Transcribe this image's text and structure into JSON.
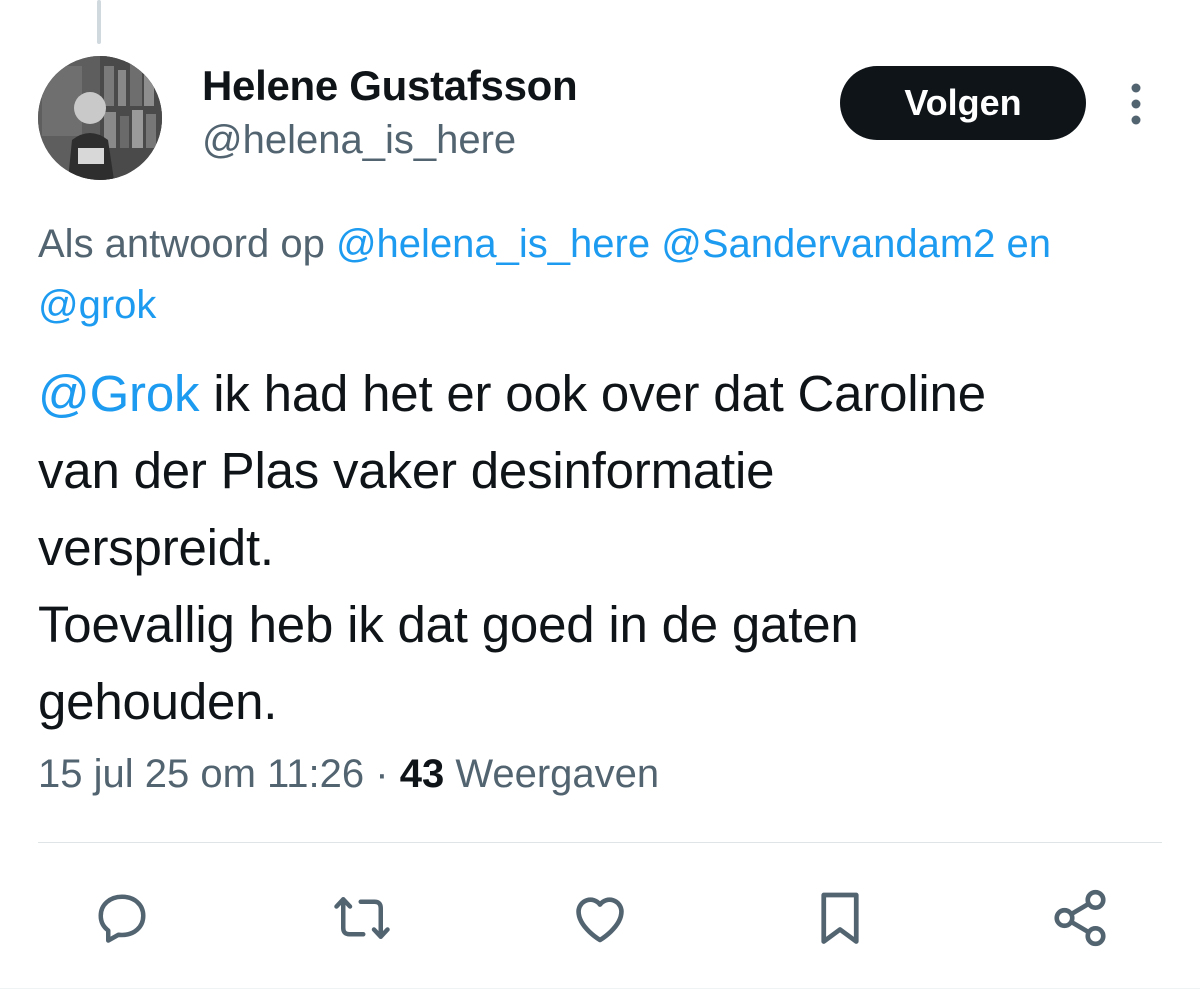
{
  "tweet": {
    "author": {
      "name": "Helene Gustafsson",
      "handle": "@helena_is_here"
    },
    "follow_label": "Volgen",
    "reply_context": {
      "prefix": "Als antwoord op ",
      "mention_1": "@helena_is_here",
      "mention_2": "@Sandervandam2",
      "conjunction": " en",
      "mention_3": "@grok"
    },
    "text": {
      "mention": "@Grok",
      "line1_rest": " ik had het er ook over dat Caroline",
      "line2": "van der Plas vaker desinformatie",
      "line3": "verspreidt.",
      "line4": "Toevallig heb ik dat goed in de gaten",
      "line5": "gehouden."
    },
    "meta": {
      "timestamp": "15 jul 25 om 11:26",
      "separator": " · ",
      "views_count": "43",
      "views_label": " Weergaven"
    }
  },
  "actions": [
    {
      "icon": "reply-icon"
    },
    {
      "icon": "retweet-icon"
    },
    {
      "icon": "like-icon"
    },
    {
      "icon": "bookmark-icon"
    },
    {
      "icon": "share-icon"
    }
  ],
  "colors": {
    "accent_link": "#1d9bf0",
    "text_primary": "#0f1419",
    "text_secondary": "#536471",
    "icon": "#536471",
    "button_bg": "#0f1419"
  }
}
